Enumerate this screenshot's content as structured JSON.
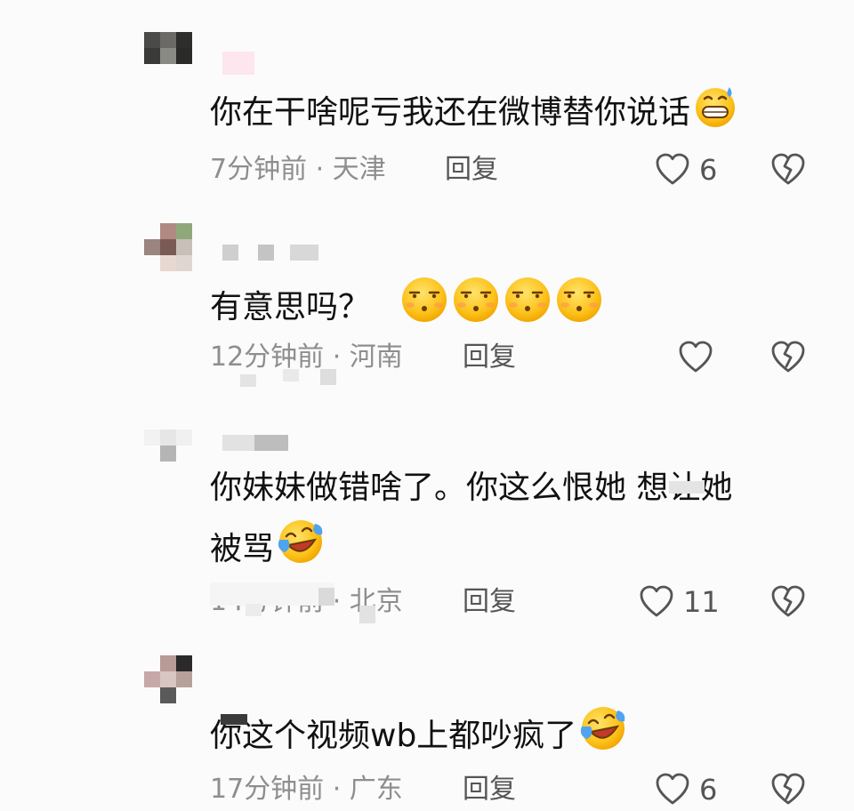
{
  "comments": [
    {
      "text": "你在干啥呢亏我还在微博替你说话",
      "time_location": "7分钟前 · 天津",
      "reply_label": "回复",
      "likes": "6",
      "emoji": [
        "grin-sweat-emoji"
      ]
    },
    {
      "text": "有意思吗？",
      "time_location": "12分钟前 · 河南",
      "reply_label": "回复",
      "likes": "",
      "emoji": [
        "unamused-emoji",
        "unamused-emoji",
        "unamused-emoji",
        "unamused-emoji"
      ]
    },
    {
      "text_line1": "你妹妹做错啥了。你这么恨她  想让她",
      "text_line2": "被骂",
      "time_location": "14分钟前 · 北京",
      "reply_label": "回复",
      "likes": "11",
      "emoji": [
        "crying-laughing-emoji"
      ]
    },
    {
      "text": "你这个视频wb上都吵疯了",
      "time_location": "17分钟前 · 广东",
      "reply_label": "回复",
      "likes": "6",
      "emoji": [
        "crying-laughing-emoji"
      ]
    }
  ],
  "colors": {
    "background": "#fbfbfb",
    "text": "#111111",
    "meta": "#8e8e8e",
    "icon": "#555555",
    "emoji_yellow": "#fcc21b"
  }
}
